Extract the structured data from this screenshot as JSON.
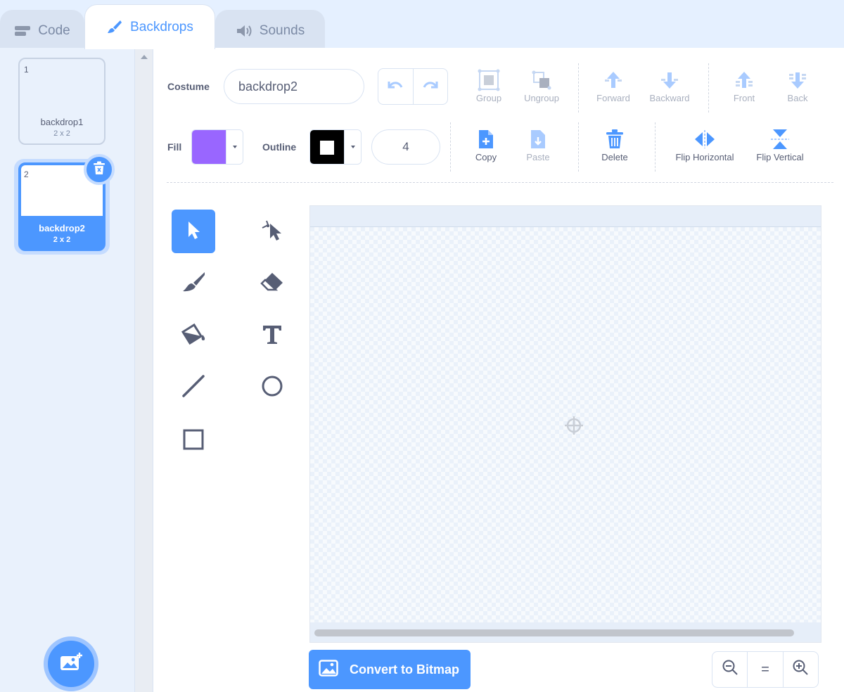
{
  "tabs": [
    {
      "label": "Code",
      "icon": "code-blocks-icon"
    },
    {
      "label": "Backdrops",
      "icon": "paintbrush-icon"
    },
    {
      "label": "Sounds",
      "icon": "speaker-icon"
    }
  ],
  "backdrops": [
    {
      "index": "1",
      "name": "backdrop1",
      "size": "2 x 2"
    },
    {
      "index": "2",
      "name": "backdrop2",
      "size": "2 x 2"
    }
  ],
  "toolbar": {
    "costume_label": "Costume",
    "costume_name": "backdrop2",
    "group": "Group",
    "ungroup": "Ungroup",
    "forward": "Forward",
    "backward": "Backward",
    "front": "Front",
    "back": "Back",
    "fill_label": "Fill",
    "outline_label": "Outline",
    "outline_width": "4",
    "copy": "Copy",
    "paste": "Paste",
    "delete": "Delete",
    "flip_horizontal": "Flip Horizontal",
    "flip_vertical": "Flip Vertical"
  },
  "colors": {
    "accent": "#4c97ff",
    "fill": "#9966ff",
    "outline": "#000000"
  },
  "canvas_footer": {
    "convert_label": "Convert to Bitmap",
    "zoom_reset": "="
  }
}
